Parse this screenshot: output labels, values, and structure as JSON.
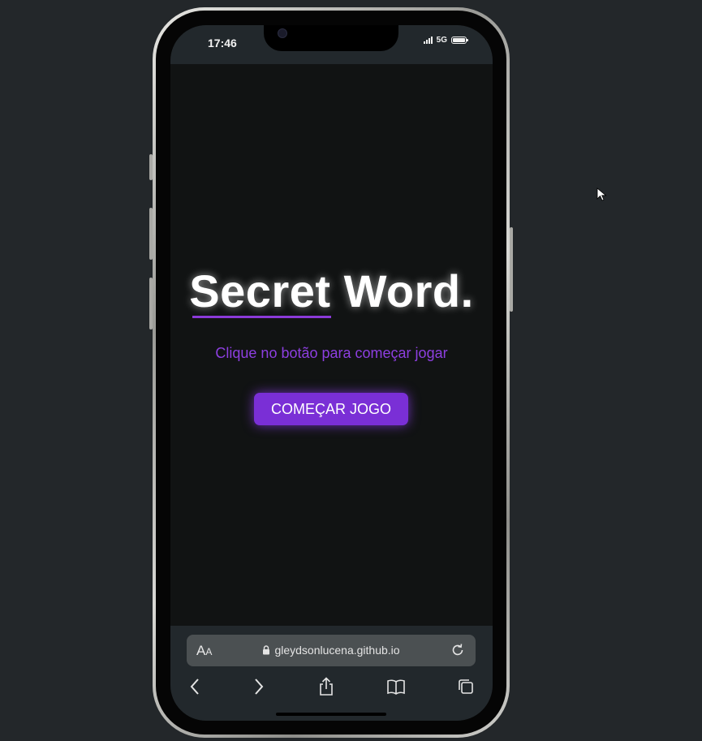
{
  "status_bar": {
    "time": "17:46",
    "network": "5G",
    "battery_level": 1.0
  },
  "page": {
    "title": "Secret Word.",
    "subtitle": "Clique no botão para começar jogar",
    "start_button_label": "COMEÇAR JOGO"
  },
  "browser": {
    "text_size_label_large": "A",
    "text_size_label_small": "A",
    "url": "gleydsonlucena.github.io",
    "icons": [
      "back-icon",
      "forward-icon",
      "share-icon",
      "bookmarks-icon",
      "tabs-icon",
      "reload-icon",
      "lock-icon"
    ]
  },
  "colors": {
    "accent": "#7a2fd6",
    "subtitle": "#8d3fe0",
    "background": "#111313",
    "outer_background": "#23272a"
  }
}
